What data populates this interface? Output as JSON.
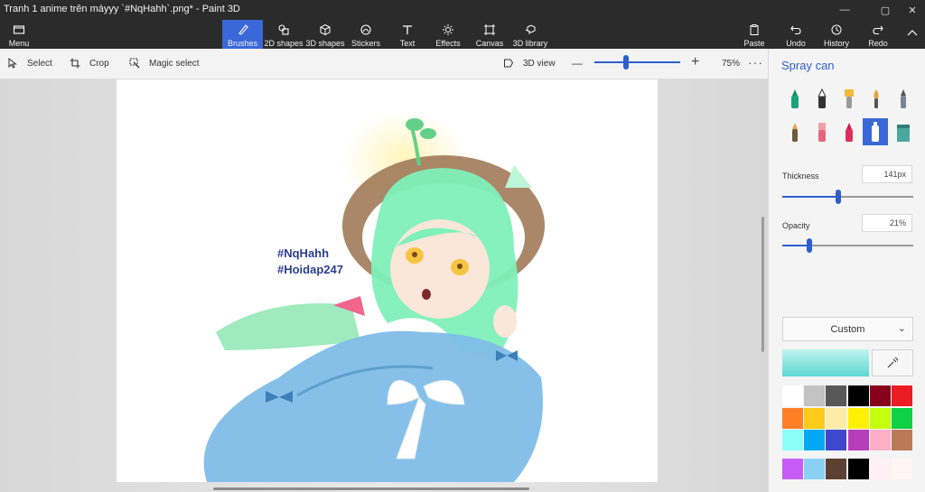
{
  "window": {
    "title": "Tranh 1 anime trên máyyy `#NqHahh`.png* - Paint 3D",
    "controls": [
      "—",
      "▢",
      "✕"
    ]
  },
  "ribbon": {
    "menu": "Menu",
    "brushes": "Brushes",
    "shapes2d": "2D shapes",
    "shapes3d": "3D shapes",
    "stickers": "Stickers",
    "text": "Text",
    "effects": "Effects",
    "canvas": "Canvas",
    "library3d": "3D library",
    "paste": "Paste",
    "undo": "Undo",
    "history": "History",
    "redo": "Redo"
  },
  "toolbar": {
    "select": "Select",
    "crop": "Crop",
    "magic_select": "Magic select",
    "view3d": "3D view",
    "zoom_minus": "—",
    "zoom_plus": "+",
    "zoom": "75%",
    "more": "···"
  },
  "canvas": {
    "hashtag1": "#NqHahh",
    "hashtag2": "#Hoidap247"
  },
  "panel": {
    "title": "Spray can",
    "thickness_label": "Thickness",
    "thickness_value": "141px",
    "thickness_fraction": 0.43,
    "opacity_label": "Opacity",
    "opacity_value": "21%",
    "opacity_fraction": 0.21,
    "color_mode": "Custom",
    "chevron": "⌄",
    "brushes": [
      "marker",
      "calligraphy-pen",
      "oil-brush",
      "watercolor",
      "pencil",
      "crayon",
      "pixel-pen",
      "spray-highlighter",
      "spray-can",
      "fill-bucket"
    ],
    "palette": [
      "#ffffff",
      "#c3c3c3",
      "#585858",
      "#000000",
      "#88001b",
      "#ec1c24",
      "#ff7f27",
      "#ffca18",
      "#fdeca6",
      "#fff200",
      "#c4ff0e",
      "#0ed145",
      "#8cfffb",
      "#00a8f3",
      "#3f48cc",
      "#b83dba",
      "#ffaec8",
      "#b97a56"
    ],
    "custom_colors": [
      "#c75cf8",
      "#8ad0f5",
      "#5c4033",
      "#000000",
      "#fff0f5",
      "#fff5f5"
    ]
  }
}
